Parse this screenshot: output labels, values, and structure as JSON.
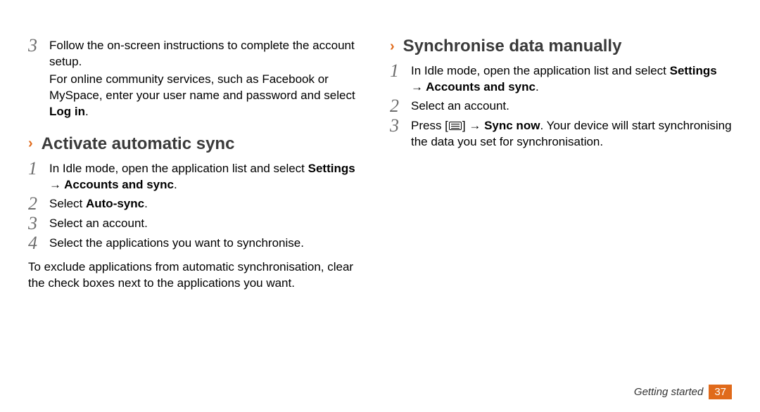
{
  "left": {
    "step3": {
      "num": "3",
      "p1": "Follow the on-screen instructions to complete the account setup.",
      "p2a": "For online community services, such as Facebook or MySpace, enter your user name and password and select ",
      "p2b": "Log in",
      "p2c": "."
    },
    "heading": "Activate automatic sync",
    "s1": {
      "num": "1",
      "a": "In Idle mode, open the application list and select ",
      "b": "Settings → Accounts and sync",
      "c": "."
    },
    "s2": {
      "num": "2",
      "a": "Select ",
      "b": "Auto-sync",
      "c": "."
    },
    "s3": {
      "num": "3",
      "a": "Select an account."
    },
    "s4": {
      "num": "4",
      "a": "Select the applications you want to synchronise."
    },
    "note": "To exclude applications from automatic synchronisation, clear the check boxes next to the applications you want."
  },
  "right": {
    "heading": "Synchronise data manually",
    "s1": {
      "num": "1",
      "a": "In Idle mode, open the application list and select ",
      "b": "Settings → Accounts and sync",
      "c": "."
    },
    "s2": {
      "num": "2",
      "a": "Select an account."
    },
    "s3": {
      "num": "3",
      "a": "Press [",
      "b": "] → ",
      "c": "Sync now",
      "d": ". Your device will start synchronising the data you set for synchronisation."
    }
  },
  "footer": {
    "section": "Getting started",
    "page": "37"
  }
}
